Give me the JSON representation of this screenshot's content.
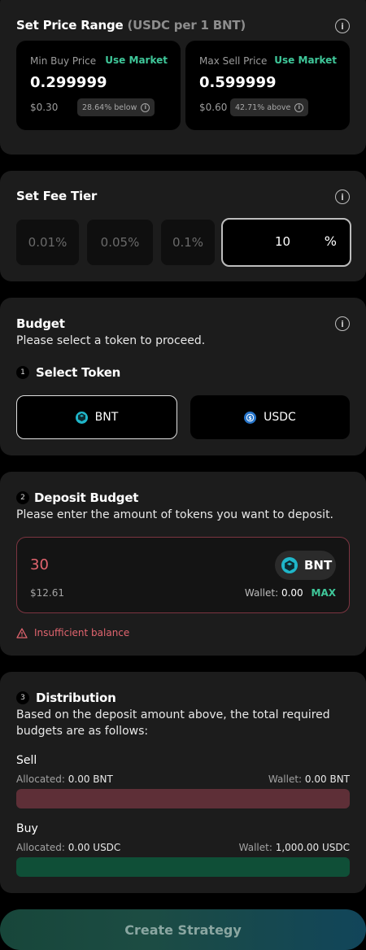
{
  "price_range": {
    "title": "Set Price Range",
    "unit": "(USDC per 1 BNT)",
    "min": {
      "label": "Min Buy Price",
      "use_market": "Use Market",
      "value": "0.299999",
      "usd": "$0.30",
      "pct": "28.64% below"
    },
    "max": {
      "label": "Max Sell Price",
      "use_market": "Use Market",
      "value": "0.599999",
      "usd": "$0.60",
      "pct": "42.71% above"
    }
  },
  "fee_tier": {
    "title": "Set Fee Tier",
    "options": [
      "0.01%",
      "0.05%",
      "0.1%"
    ],
    "custom_value": "10",
    "custom_unit": "%"
  },
  "budget": {
    "title": "Budget",
    "subtitle": "Please select a token to proceed.",
    "step1_num": "1",
    "step1_label": "Select Token",
    "tokens": [
      "BNT",
      "USDC"
    ],
    "selected": "BNT"
  },
  "deposit": {
    "step_num": "2",
    "title": "Deposit Budget",
    "subtitle": "Please enter the amount of tokens you want to deposit.",
    "amount": "30",
    "token": "BNT",
    "usd": "$12.61",
    "wallet_label": "Wallet:",
    "wallet_value": "0.00",
    "max_label": "MAX",
    "error": "Insufficient balance"
  },
  "distribution": {
    "step_num": "3",
    "title": "Distribution",
    "desc_line1": "Based on the deposit amount above, the total required",
    "desc_line2": "budgets are as follows:",
    "sell": {
      "label": "Sell",
      "allocated_label": "Allocated:",
      "allocated": "0.00 BNT",
      "wallet_label": "Wallet:",
      "wallet": "0.00 BNT"
    },
    "buy": {
      "label": "Buy",
      "allocated_label": "Allocated:",
      "allocated": "0.00 USDC",
      "wallet_label": "Wallet:",
      "wallet": "1,000.00 USDC"
    }
  },
  "create_button": "Create Strategy",
  "colors": {
    "accent_green": "#3fc89a",
    "error_red": "#e2656f",
    "sell_bar": "#5e2f37",
    "buy_bar": "#0f4f37"
  },
  "icons": {
    "info": "info-icon",
    "bnt": "bancor-icon",
    "usdc": "usdc-icon",
    "warning": "warning-icon"
  }
}
